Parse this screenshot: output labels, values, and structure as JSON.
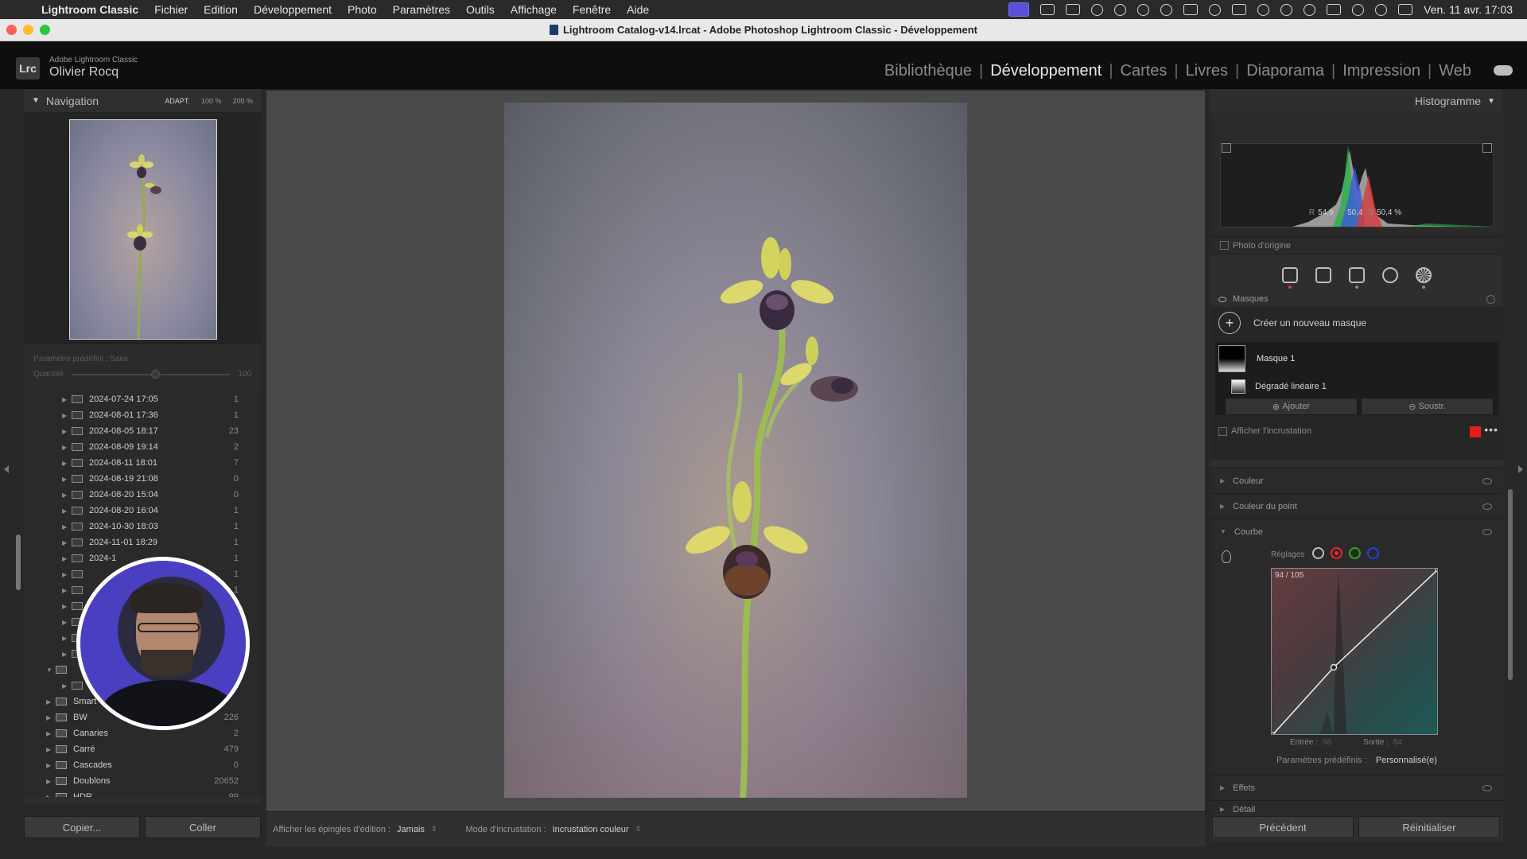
{
  "menubar": {
    "app_name": "Lightroom Classic",
    "items": [
      "Fichier",
      "Edition",
      "Développement",
      "Photo",
      "Paramètres",
      "Outils",
      "Affichage",
      "Fenêtre",
      "Aide"
    ],
    "clock": "Ven. 11 avr.  17:03"
  },
  "window": {
    "title": "Lightroom Catalog-v14.lrcat - Adobe Photoshop Lightroom Classic - Développement"
  },
  "identity": {
    "logo": "Lrc",
    "product": "Adobe Lightroom Classic",
    "user": "Olivier Rocq"
  },
  "modules": {
    "items": [
      "Bibliothèque",
      "Développement",
      "Cartes",
      "Livres",
      "Diaporama",
      "Impression",
      "Web"
    ],
    "active": "Développement"
  },
  "navigator": {
    "title": "Navigation",
    "zoom_options": [
      "ADAPT.",
      "100 %",
      "200 %"
    ]
  },
  "preset": {
    "label": "Paramètre prédéfini :",
    "value": "Sans",
    "quantity_label": "Quantité",
    "quantity_value": "100"
  },
  "folders": [
    {
      "name": "2024-07-24 17:05",
      "count": "1",
      "level": 2
    },
    {
      "name": "2024-08-01 17:36",
      "count": "1",
      "level": 2
    },
    {
      "name": "2024-08-05 18:17",
      "count": "23",
      "level": 2
    },
    {
      "name": "2024-08-09 19:14",
      "count": "2",
      "level": 2
    },
    {
      "name": "2024-08-11 18:01",
      "count": "7",
      "level": 2
    },
    {
      "name": "2024-08-19 21:08",
      "count": "0",
      "level": 2
    },
    {
      "name": "2024-08-20 15:04",
      "count": "0",
      "level": 2
    },
    {
      "name": "2024-08-20 16:04",
      "count": "1",
      "level": 2
    },
    {
      "name": "2024-10-30 18:03",
      "count": "1",
      "level": 2
    },
    {
      "name": "2024-11-01 18:29",
      "count": "1",
      "level": 2
    },
    {
      "name": "2024-1",
      "count": "1",
      "level": 2
    },
    {
      "name": "",
      "count": "1",
      "level": 2
    },
    {
      "name": "",
      "count": "1",
      "level": 2
    },
    {
      "name": "",
      "count": "",
      "level": 2
    },
    {
      "name": "",
      "count": "",
      "level": 2
    },
    {
      "name": "",
      "count": "",
      "level": 2
    },
    {
      "name": "",
      "count": "",
      "level": 2
    },
    {
      "name": "",
      "count": "",
      "level": 1
    },
    {
      "name": "",
      "count": "1",
      "level": 2
    },
    {
      "name": "Smart",
      "count": "",
      "level": 1
    },
    {
      "name": "BW",
      "count": "226",
      "level": 1
    },
    {
      "name": "Canaries",
      "count": "2",
      "level": 1
    },
    {
      "name": "Carré",
      "count": "479",
      "level": 1
    },
    {
      "name": "Cascades",
      "count": "0",
      "level": 1
    },
    {
      "name": "Doublons",
      "count": "20652",
      "level": 1
    },
    {
      "name": "HDR",
      "count": "99",
      "level": 1
    }
  ],
  "left_buttons": {
    "copy": "Copier...",
    "paste": "Coller"
  },
  "toolbar": {
    "pins_label": "Afficher les épingles d'édition :",
    "pins_value": "Jamais",
    "overlay_label": "Mode d'incrustation :",
    "overlay_value": "Incrustation couleur"
  },
  "histogram": {
    "title": "Histogramme",
    "r_label": "R",
    "r_value": "54,9",
    "v_label": "V",
    "v_value": "50,4",
    "b_label": "B",
    "b_value": "50,4 %",
    "original_label": "Photo d'origine"
  },
  "masks": {
    "title": "Masques",
    "create": "Créer un nouveau masque",
    "mask1": "Masque 1",
    "gradient": "Dégradé linéaire 1",
    "add": "Ajouter",
    "subtract": "Soustr.",
    "show_overlay": "Afficher l'incrustation",
    "overlay_color": "#e41e1e"
  },
  "sections": {
    "color": "Couleur",
    "point_color": "Couleur du point",
    "curve": "Courbe",
    "effects": "Effets",
    "detail": "Détail"
  },
  "curve": {
    "reglages": "Réglages",
    "readout": "94 / 105",
    "input_label": "Entrée :",
    "input_value": "98",
    "output_label": "Sortie :",
    "output_value": "84",
    "preset_label": "Paramètres prédéfinis :",
    "preset_value": "Personnalisé(e)"
  },
  "right_buttons": {
    "previous": "Précédent",
    "reset": "Réinitialiser"
  }
}
